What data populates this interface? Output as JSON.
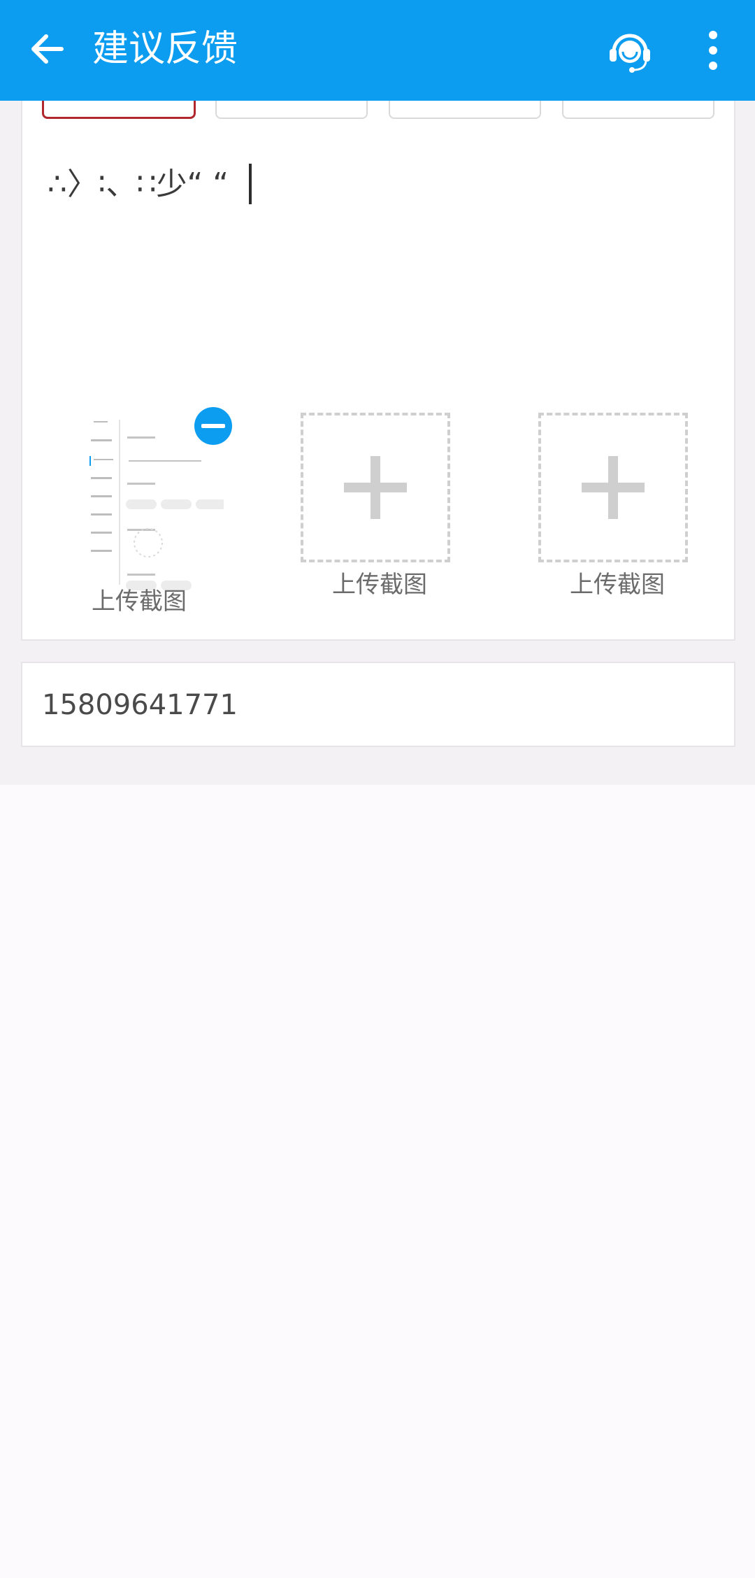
{
  "appbar": {
    "title": "建议反馈",
    "back_icon": "arrow-left-icon",
    "support_icon": "headset-icon",
    "more_icon": "more-vertical-icon",
    "color": "#0c9df0"
  },
  "feedback": {
    "text": "∴〉∶、∷少“ “"
  },
  "uploads": [
    {
      "label": "上传截图",
      "state": "uploaded"
    },
    {
      "label": "上传截图",
      "state": "empty"
    },
    {
      "label": "上传截图",
      "state": "empty"
    }
  ],
  "contact": {
    "phone": "15809641771"
  }
}
